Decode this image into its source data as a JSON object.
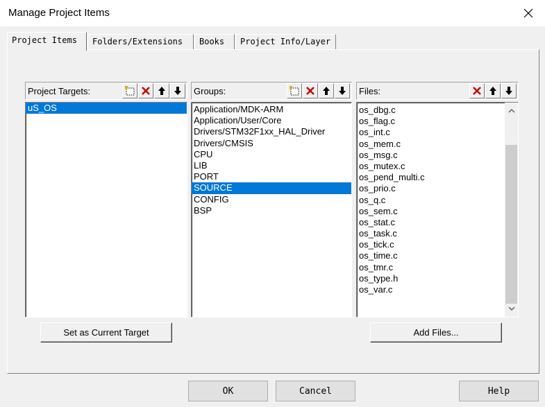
{
  "window": {
    "title": "Manage Project Items"
  },
  "tabs": [
    {
      "label": "Project Items",
      "active": true
    },
    {
      "label": "Folders/Extensions",
      "active": false
    },
    {
      "label": "Books",
      "active": false
    },
    {
      "label": "Project Info/Layer",
      "active": false
    }
  ],
  "targets": {
    "label": "Project Targets:",
    "items": [
      {
        "name": "uS_OS",
        "selected": true
      }
    ],
    "tools": [
      "new-icon",
      "delete-icon",
      "move-up-icon",
      "move-down-icon"
    ]
  },
  "groups": {
    "label": "Groups:",
    "items": [
      {
        "name": "Application/MDK-ARM",
        "selected": false
      },
      {
        "name": "Application/User/Core",
        "selected": false
      },
      {
        "name": "Drivers/STM32F1xx_HAL_Driver",
        "selected": false
      },
      {
        "name": "Drivers/CMSIS",
        "selected": false
      },
      {
        "name": "CPU",
        "selected": false
      },
      {
        "name": "LIB",
        "selected": false
      },
      {
        "name": "PORT",
        "selected": false
      },
      {
        "name": "SOURCE",
        "selected": true
      },
      {
        "name": "CONFIG",
        "selected": false
      },
      {
        "name": "BSP",
        "selected": false
      }
    ],
    "tools": [
      "new-icon",
      "delete-icon",
      "move-up-icon",
      "move-down-icon"
    ]
  },
  "files": {
    "label": "Files:",
    "items": [
      "os_dbg.c",
      "os_flag.c",
      "os_int.c",
      "os_mem.c",
      "os_msg.c",
      "os_mutex.c",
      "os_pend_multi.c",
      "os_prio.c",
      "os_q.c",
      "os_sem.c",
      "os_stat.c",
      "os_task.c",
      "os_tick.c",
      "os_time.c",
      "os_tmr.c",
      "os_type.h",
      "os_var.c"
    ],
    "tools": [
      "delete-icon",
      "move-up-icon",
      "move-down-icon"
    ]
  },
  "buttons": {
    "set_current_target": "Set as Current Target",
    "add_files": "Add Files...",
    "ok": "OK",
    "cancel": "Cancel",
    "help": "Help"
  },
  "colors": {
    "selection": "#0078d7",
    "delete_icon": "#c00000"
  }
}
